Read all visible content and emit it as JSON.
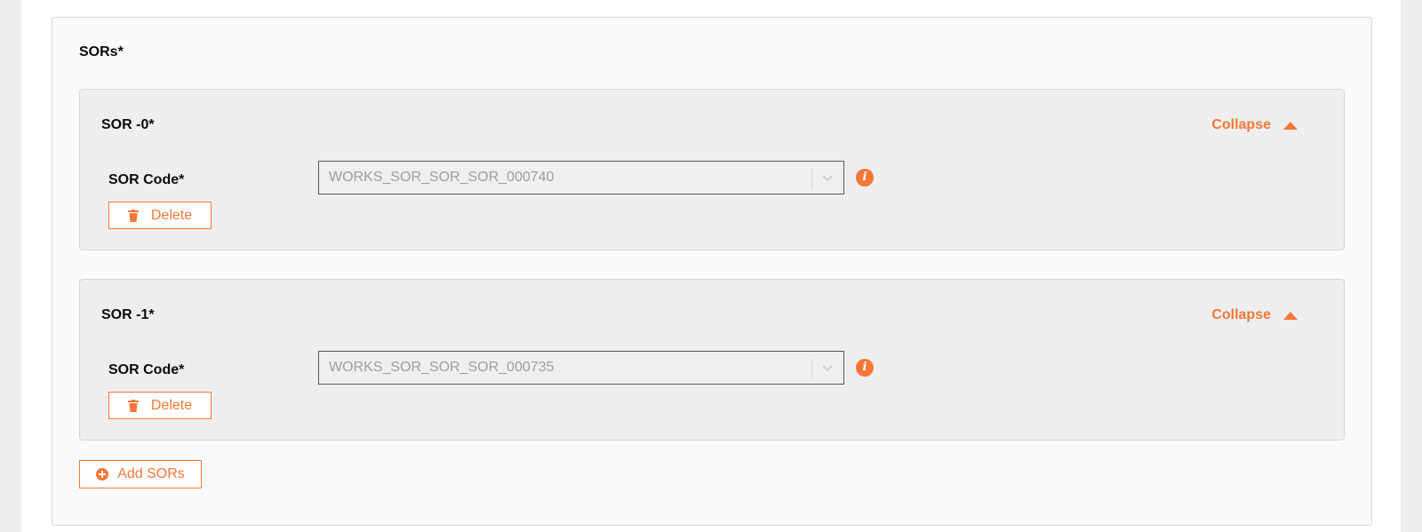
{
  "section": {
    "title": "SORs*"
  },
  "sors": [
    {
      "title": "SOR -0*",
      "collapse_label": "Collapse",
      "field_label": "SOR Code*",
      "value": "WORKS_SOR_SOR_SOR_000740",
      "delete_label": "Delete"
    },
    {
      "title": "SOR -1*",
      "collapse_label": "Collapse",
      "field_label": "SOR Code*",
      "value": "WORKS_SOR_SOR_SOR_000735",
      "delete_label": "Delete"
    }
  ],
  "add_button": {
    "label": "Add SORs"
  },
  "icons": {
    "collapse": "chevron-up-icon",
    "select": "chevron-down-icon",
    "info": "info-icon",
    "delete": "trash-icon",
    "add": "plus-circle-icon"
  },
  "colors": {
    "accent": "#f47738",
    "card_bg": "#eeeeee",
    "section_bg": "#fafafa"
  }
}
